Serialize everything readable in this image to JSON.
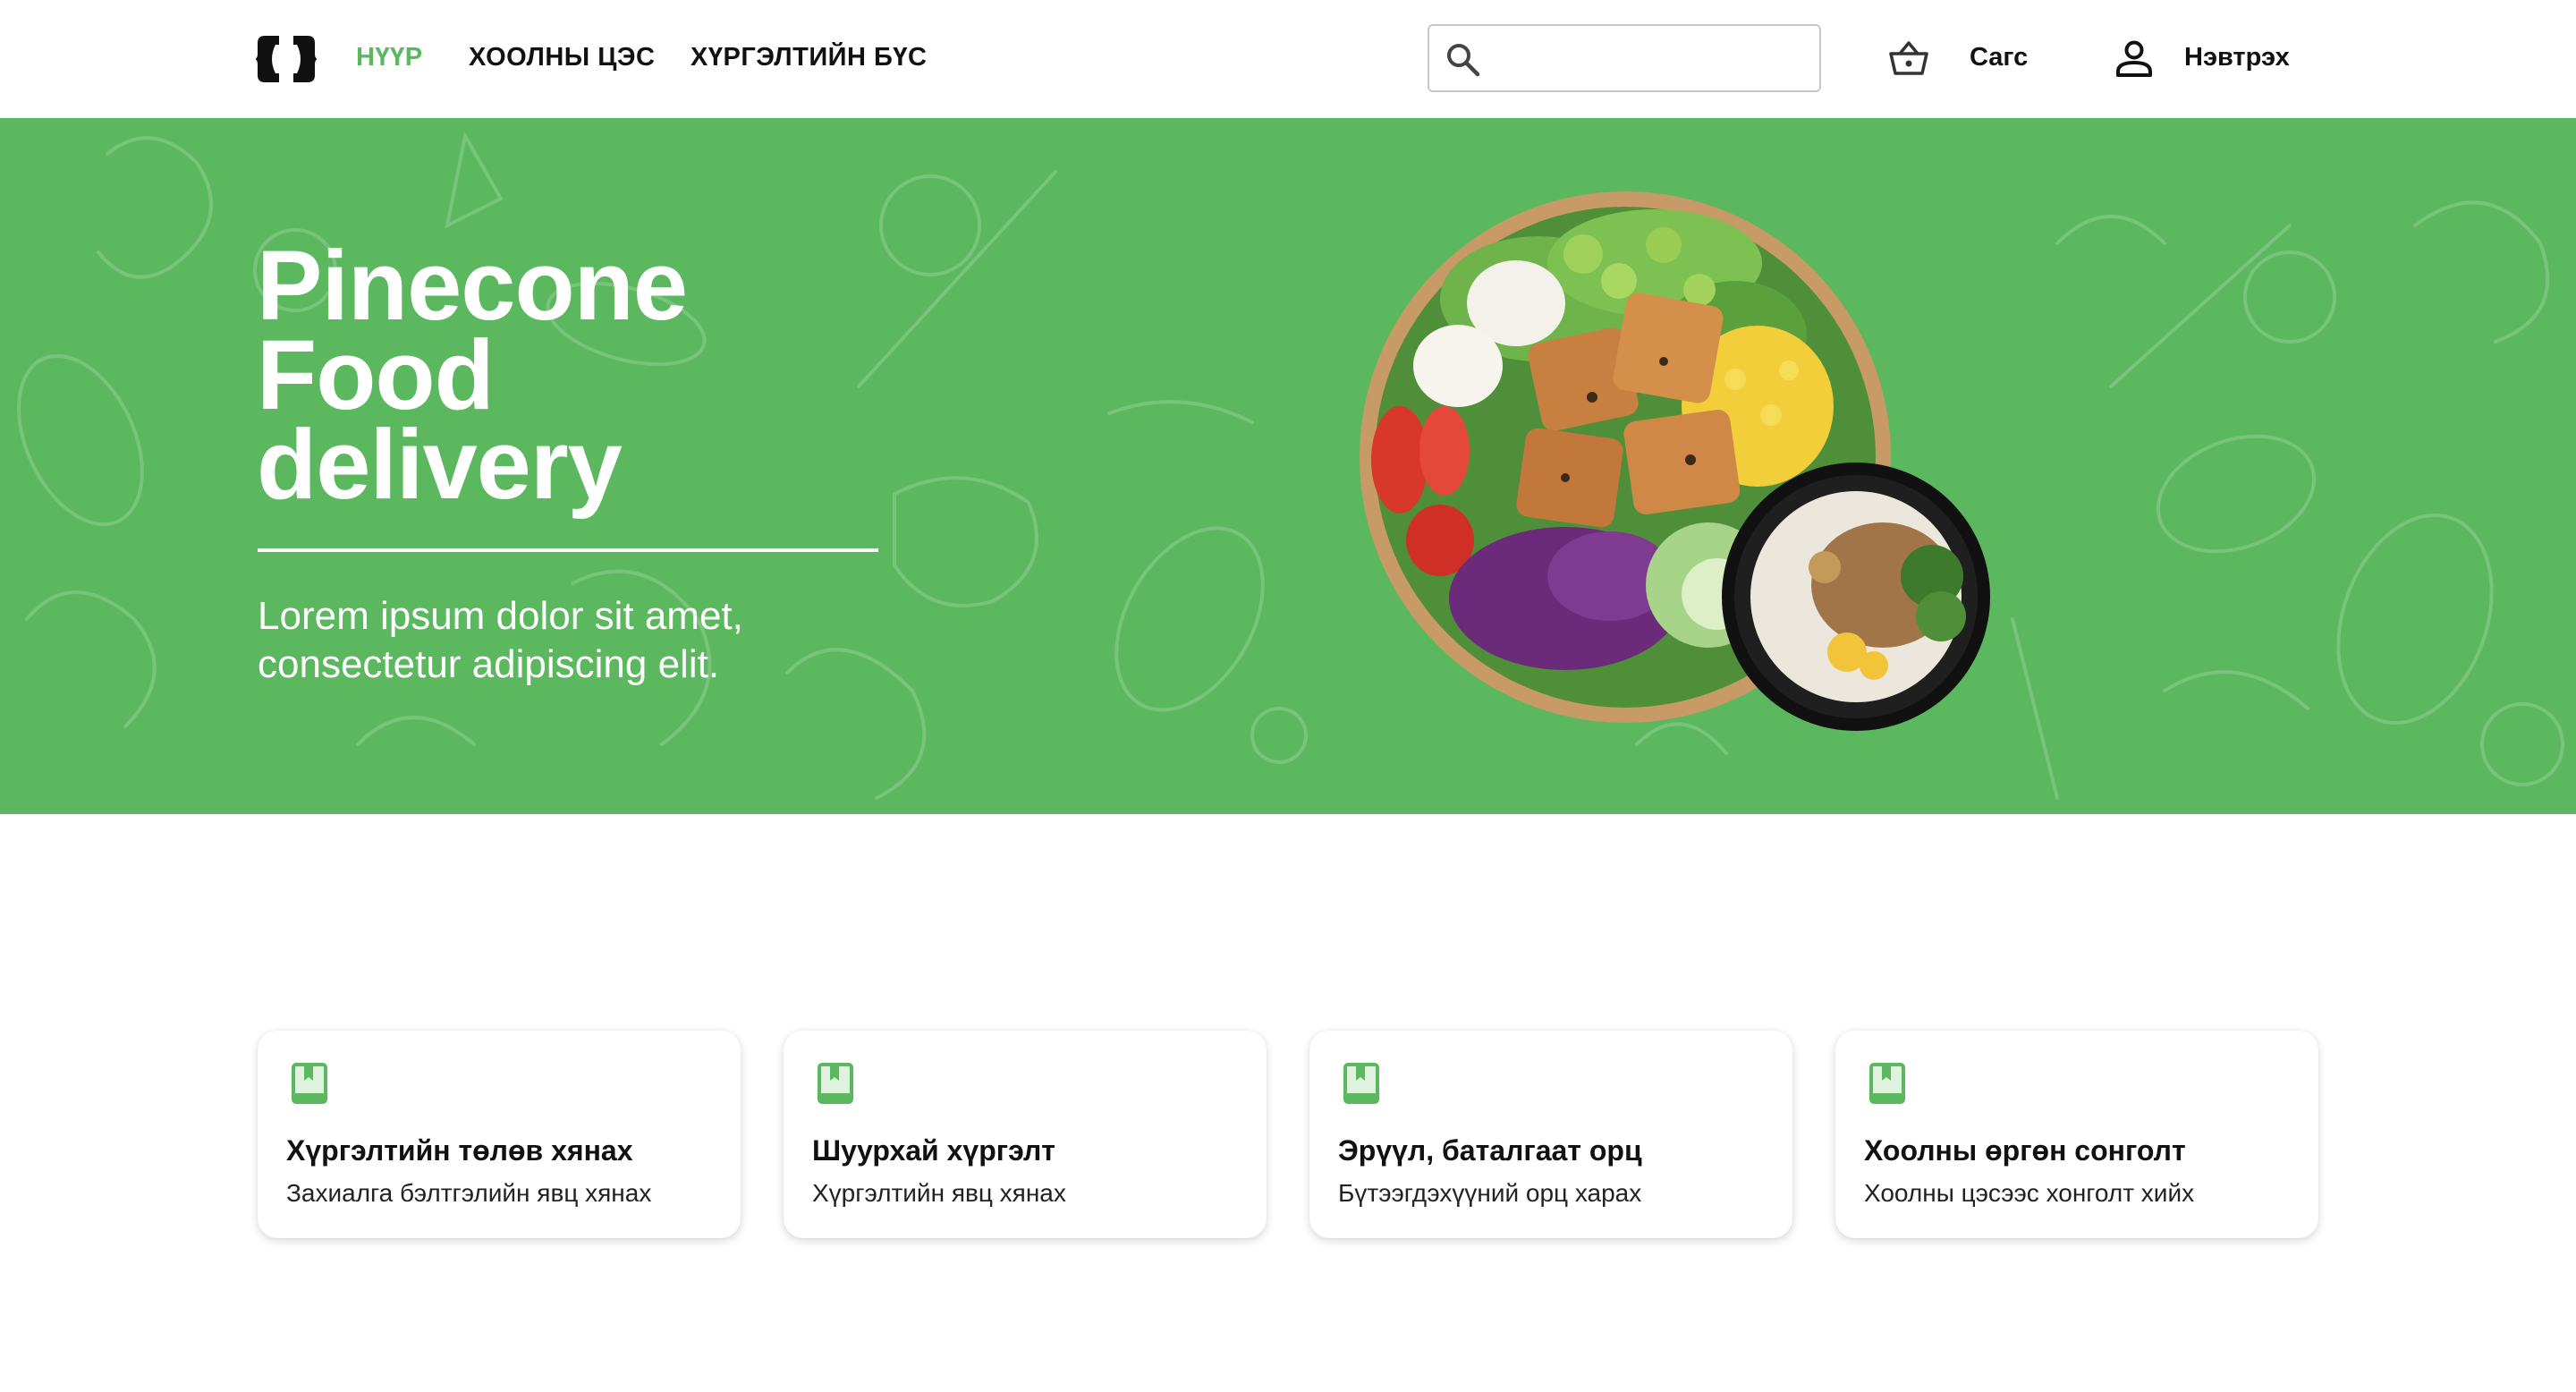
{
  "nav": {
    "links": [
      {
        "label": "НҮҮР",
        "active": true
      },
      {
        "label": "ХООЛНЫ ЦЭС",
        "active": false
      },
      {
        "label": "ХҮРГЭЛТИЙН БҮС",
        "active": false
      }
    ],
    "search": {
      "value": "",
      "placeholder": "",
      "icon": "search-icon"
    },
    "cart": {
      "label": "Сагс",
      "icon": "basket-icon"
    },
    "login": {
      "label": "Нэвтрэх",
      "icon": "user-icon"
    }
  },
  "hero": {
    "title_lines": [
      "Pinecone",
      "Food",
      "delivery"
    ],
    "subtitle_lines": [
      "Lorem ipsum dolor sit amet,",
      "consectetur adipiscing elit."
    ],
    "image": "food-bowl-image"
  },
  "features": [
    {
      "title": "Хүргэлтийн төлөв хянах",
      "description": "Захиалга бэлтгэлийн явц хянах",
      "icon": "book-icon"
    },
    {
      "title": "Шуурхай хүргэлт",
      "description": "Хүргэлтийн явц хянах",
      "icon": "book-icon"
    },
    {
      "title": "Эрүүл, баталгаат орц",
      "description": "Бүтээгдэхүүний орц харах",
      "icon": "book-icon"
    },
    {
      "title": "Хоолны өргөн сонголт",
      "description": "Хоолны цэсээс хонголт хийх",
      "icon": "book-icon"
    }
  ],
  "colors": {
    "accent": "#5bb85e",
    "text": "#111111",
    "background": "#ffffff"
  }
}
